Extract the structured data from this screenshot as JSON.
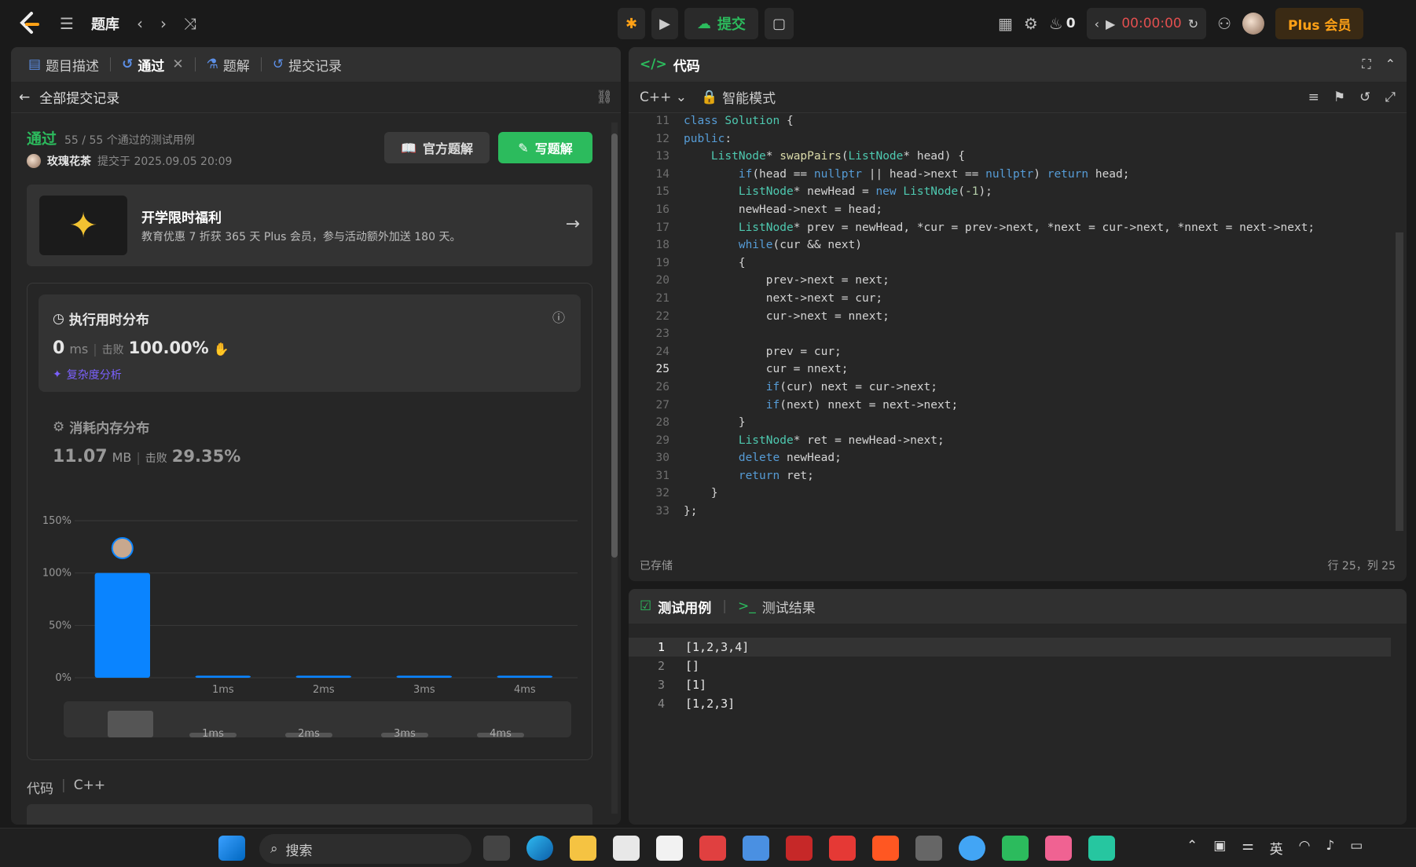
{
  "topbar": {
    "title": "题库",
    "submit": "提交",
    "fire_count": "0",
    "timer": "00:00:00",
    "plus": "Plus 会员"
  },
  "left_tabs": [
    {
      "label": "题目描述"
    },
    {
      "label": "通过"
    },
    {
      "label": "题解"
    },
    {
      "label": "提交记录"
    }
  ],
  "back_label": "全部提交记录",
  "submission": {
    "status": "通过",
    "cases": "55 / 55 个通过的测试用例",
    "user": "玫瑰花茶",
    "time": "提交于 2025.09.05 20:09"
  },
  "buttons": {
    "official": "官方题解",
    "write": "写题解"
  },
  "promo": {
    "title": "开学限时福利",
    "desc": "教育优惠 7 折获 365 天 Plus 会员，参与活动额外加送 180 天。"
  },
  "runtime": {
    "title": "执行用时分布",
    "value": "0",
    "unit": "ms",
    "beat_label": "击败",
    "beat": "100.00%",
    "complexity": "复杂度分析"
  },
  "memory": {
    "title": "消耗内存分布",
    "value": "11.07",
    "unit": "MB",
    "beat_label": "击败",
    "beat": "29.35%"
  },
  "chart_data": {
    "type": "bar",
    "categories": [
      "",
      "1ms",
      "2ms",
      "3ms",
      "4ms"
    ],
    "values": [
      100,
      2,
      2,
      2,
      2
    ],
    "y_ticks": [
      "150%",
      "100%",
      "50%",
      "0%"
    ],
    "ylim": [
      0,
      150
    ],
    "overview_labels": [
      "1ms",
      "2ms",
      "3ms",
      "4ms"
    ]
  },
  "code_section": {
    "label": "代码",
    "lang": "C++"
  },
  "code_panel": {
    "title": "代码",
    "lang": "C++",
    "mode": "智能模式",
    "saved": "已存储",
    "cursor": "行 25，列 25"
  },
  "code_lines": [
    {
      "n": "11",
      "t": "class Solution {"
    },
    {
      "n": "12",
      "t": "public:"
    },
    {
      "n": "13",
      "t": "    ListNode* swapPairs(ListNode* head) {"
    },
    {
      "n": "14",
      "t": "        if(head == nullptr || head->next == nullptr) return head;"
    },
    {
      "n": "15",
      "t": "        ListNode* newHead = new ListNode(-1);"
    },
    {
      "n": "16",
      "t": "        newHead->next = head;"
    },
    {
      "n": "17",
      "t": "        ListNode* prev = newHead, *cur = prev->next, *next = cur->next, *nnext = next->next;"
    },
    {
      "n": "18",
      "t": "        while(cur && next)"
    },
    {
      "n": "19",
      "t": "        {"
    },
    {
      "n": "20",
      "t": "            prev->next = next;"
    },
    {
      "n": "21",
      "t": "            next->next = cur;"
    },
    {
      "n": "22",
      "t": "            cur->next = nnext;"
    },
    {
      "n": "23",
      "t": ""
    },
    {
      "n": "24",
      "t": "            prev = cur;"
    },
    {
      "n": "25",
      "t": "            cur = nnext;"
    },
    {
      "n": "26",
      "t": "            if(cur) next = cur->next;"
    },
    {
      "n": "27",
      "t": "            if(next) nnext = next->next;"
    },
    {
      "n": "28",
      "t": "        }"
    },
    {
      "n": "29",
      "t": "        ListNode* ret = newHead->next;"
    },
    {
      "n": "30",
      "t": "        delete newHead;"
    },
    {
      "n": "31",
      "t": "        return ret;"
    },
    {
      "n": "32",
      "t": "    }"
    },
    {
      "n": "33",
      "t": "};"
    }
  ],
  "test_panel": {
    "tab1": "测试用例",
    "tab2": "测试结果",
    "rows": [
      {
        "n": "1",
        "v": "[1,2,3,4]"
      },
      {
        "n": "2",
        "v": "[]"
      },
      {
        "n": "3",
        "v": "[1]"
      },
      {
        "n": "4",
        "v": "[1,2,3]"
      }
    ]
  },
  "taskbar": {
    "search": "搜索",
    "lang": "英"
  }
}
